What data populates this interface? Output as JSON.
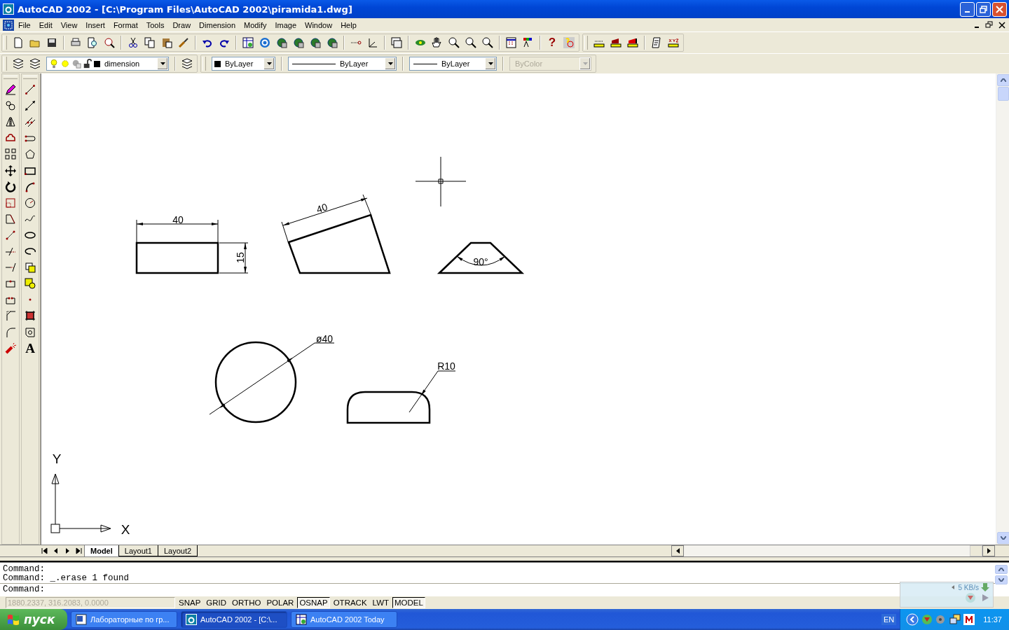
{
  "window": {
    "title": "AutoCAD 2002 - [C:\\Program Files\\AutoCAD 2002\\piramida1.dwg]"
  },
  "menu": [
    "File",
    "Edit",
    "View",
    "Insert",
    "Format",
    "Tools",
    "Draw",
    "Dimension",
    "Modify",
    "Image",
    "Window",
    "Help"
  ],
  "standard_toolbar": {
    "help_glyph": "?"
  },
  "properties": {
    "layer": "dimension",
    "color_control": "ByLayer",
    "linetype": "ByLayer",
    "lineweight": "ByLayer",
    "plot_style": {
      "value": "ByColor",
      "disabled": true
    }
  },
  "draw_toolbar": {
    "text_glyph": "A"
  },
  "annotations": [
    {
      "kind": "linear",
      "text": "40"
    },
    {
      "kind": "linear",
      "text": "15"
    },
    {
      "kind": "aligned",
      "text": "40"
    },
    {
      "kind": "angular",
      "text": "90°"
    },
    {
      "kind": "diameter",
      "text": "ø40"
    },
    {
      "kind": "radius",
      "text": "R10"
    }
  ],
  "ucs": {
    "y_label": "Y",
    "x_label": "X"
  },
  "tabs": [
    {
      "label": "Model",
      "selected": true
    },
    {
      "label": "Layout1",
      "selected": false
    },
    {
      "label": "Layout2",
      "selected": false
    }
  ],
  "command_history": [
    "Command:",
    "Command: _.erase 1 found"
  ],
  "command_prompt": "Command:",
  "net_meter": {
    "speed": "5 KB/s"
  },
  "coordinates": "1880.2337, 316.2083, 0.0000",
  "status_buttons": [
    {
      "label": "SNAP",
      "on": false
    },
    {
      "label": "GRID",
      "on": false
    },
    {
      "label": "ORTHO",
      "on": false
    },
    {
      "label": "POLAR",
      "on": false
    },
    {
      "label": "OSNAP",
      "on": true
    },
    {
      "label": "OTRACK",
      "on": false
    },
    {
      "label": "LWT",
      "on": false
    },
    {
      "label": "MODEL",
      "on": true
    }
  ],
  "taskbar": {
    "start": "пуск",
    "tasks": [
      {
        "label": "Лабораторные по гр...",
        "selected": false
      },
      {
        "label": "AutoCAD 2002 - [C:\\...",
        "selected": true
      },
      {
        "label": "AutoCAD 2002 Today",
        "selected": false
      }
    ],
    "language": "EN",
    "clock": "11:37"
  }
}
